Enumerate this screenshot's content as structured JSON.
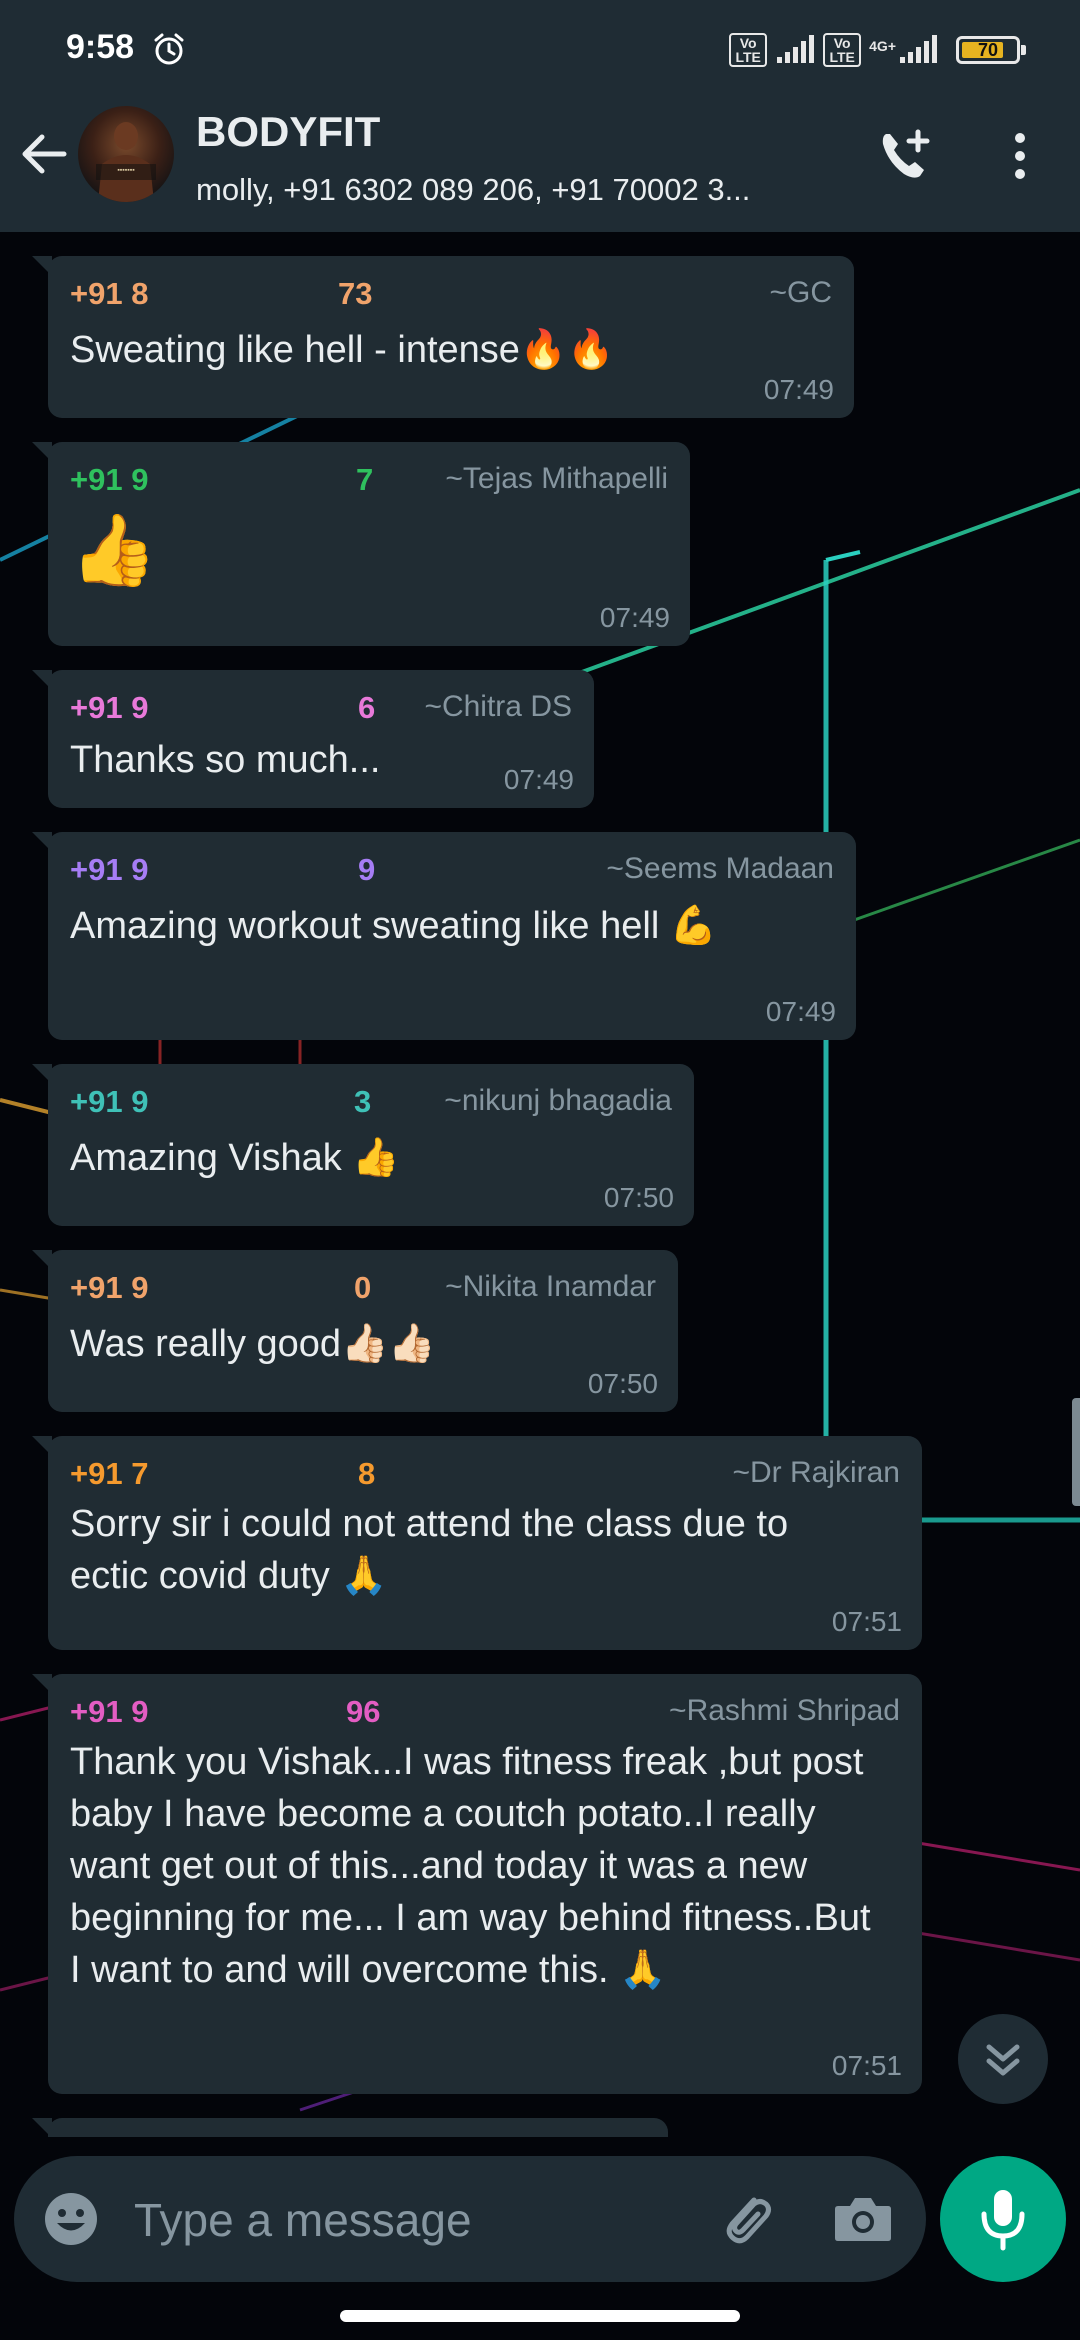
{
  "status_bar": {
    "time": "9:58",
    "sim1_label": "Vo LTE",
    "sim2_label": "Vo LTE",
    "network": "4G+",
    "battery_level": "70"
  },
  "header": {
    "group_name": "BODYFIT",
    "members": "molly, +91 6302 089 206, +91 70002 3..."
  },
  "messages": [
    {
      "phone_start": "+91 8",
      "phone_end": "73",
      "name": "~GC",
      "text": "Sweating like hell - intense🔥🔥",
      "time": "07:49",
      "color": "#f0a36b"
    },
    {
      "phone_start": "+91 9",
      "phone_end": "7",
      "name": "~Tejas Mithapelli",
      "text": "👍",
      "time": "07:49",
      "color": "#2fc15e"
    },
    {
      "phone_start": "+91 9",
      "phone_end": "6",
      "name": "~Chitra DS",
      "text": "Thanks so much...",
      "time": "07:49",
      "color": "#e879d9"
    },
    {
      "phone_start": "+91 9",
      "phone_end": "9",
      "name": "~Seems Madaan",
      "text": "Amazing workout sweating like hell 💪",
      "time": "07:49",
      "color": "#a67df5"
    },
    {
      "phone_start": "+91 9",
      "phone_end": "3",
      "name": "~nikunj bhagadia",
      "text": "Amazing Vishak 👍",
      "time": "07:50",
      "color": "#3fc1b7"
    },
    {
      "phone_start": "+91 9",
      "phone_end": "0",
      "name": "~Nikita Inamdar",
      "text": "Was really good👍🏻👍🏻",
      "time": "07:50",
      "color": "#f0a36b"
    },
    {
      "phone_start": "+91 7",
      "phone_end": "8",
      "name": "~Dr Rajkiran",
      "text": "Sorry sir i could not attend the class due to ectic covid duty 🙏",
      "time": "07:51",
      "color": "#f59a2e"
    },
    {
      "phone_start": "+91 9",
      "phone_end": "96",
      "name": "~Rashmi Shripad",
      "text": "Thank you Vishak...I was fitness freak ,but post baby I have become a coutch potato..I really want get out of this...and today it was a new beginning for me... I am way behind fitness..But I want to and will overcome this. 🙏",
      "time": "07:51",
      "color": "#e35dc3"
    }
  ],
  "composer": {
    "placeholder": "Type a message"
  }
}
